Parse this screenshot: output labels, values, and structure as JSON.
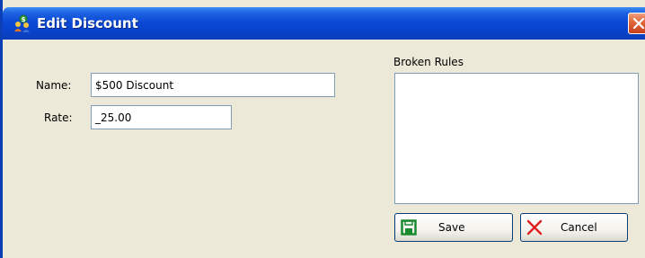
{
  "window": {
    "title": "Edit Discount",
    "title_icon": "money-people-icon",
    "close_icon": "close-icon"
  },
  "form": {
    "name_label": "Name:",
    "name_value": "$500 Discount",
    "rate_label": "Rate:",
    "rate_value": "_25.00"
  },
  "broken_rules": {
    "label": "Broken Rules"
  },
  "buttons": {
    "save_label": "Save",
    "save_icon": "save-disk-icon",
    "cancel_label": "Cancel",
    "cancel_icon": "cancel-x-icon"
  },
  "colors": {
    "titlebar": "#0842c9",
    "window_bg": "#ece9d8",
    "field_border": "#7f9db9",
    "close_button": "#e26a3c",
    "save_icon": "#1a8a2e",
    "cancel_icon": "#e02020"
  }
}
